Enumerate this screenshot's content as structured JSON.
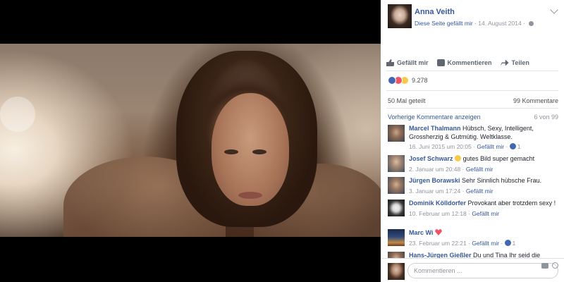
{
  "post": {
    "author": "Anna Veith",
    "like_page": "Diese Seite gefällt mir",
    "separator": "·",
    "date": "14. August 2014",
    "separator2": "·"
  },
  "actions": {
    "like": "Gefällt mir",
    "comment": "Kommentieren",
    "share": "Teilen"
  },
  "stats": {
    "reaction_count": "9.278",
    "shares": "50 Mal geteilt",
    "comments_total": "99 Kommentare",
    "prev_comments": "Vorherige Kommentare anzeigen",
    "range": "6 von 99"
  },
  "comments": [
    {
      "name": "Marcel Thalmann",
      "text": "Hübsch, Sexy, Intelligent, Grossherzig & Gutmütig. Weltklasse.",
      "date": "16. Juni 2015 um 20:05",
      "like": "Gefällt mir",
      "likes": "1"
    },
    {
      "name": "Josef Schwarz",
      "text": "gutes Bild super gemacht",
      "date": "2. Januar um 20:48",
      "like": "Gefällt mir",
      "likes": ""
    },
    {
      "name": "Jürgen Borawski",
      "text": "Sehr Sinnlich hübsche Frau.",
      "date": "3. Januar um 17:24",
      "like": "Gefällt mir",
      "likes": ""
    },
    {
      "name": "Dominik Kölldorfer",
      "text": "Provokant aber trotzdem sexy !",
      "date": "10. Februar um 12:18",
      "like": "Gefällt mir",
      "likes": ""
    },
    {
      "name": "Marc Wi",
      "text": "",
      "date": "23. Februar um 22:21",
      "like": "Gefällt mir",
      "likes": "1"
    },
    {
      "name": "Hans-Jürgen Gießler",
      "text": "Du und Tina Ihr seid die",
      "date": "",
      "like": "",
      "likes": ""
    }
  ],
  "composer": {
    "placeholder": "Kommentieren ..."
  },
  "colors": {
    "link": "#365899",
    "meta": "#90949c",
    "like_blue": "#4267b2",
    "love_red": "#f25268",
    "wow_yellow": "#f7c948"
  }
}
